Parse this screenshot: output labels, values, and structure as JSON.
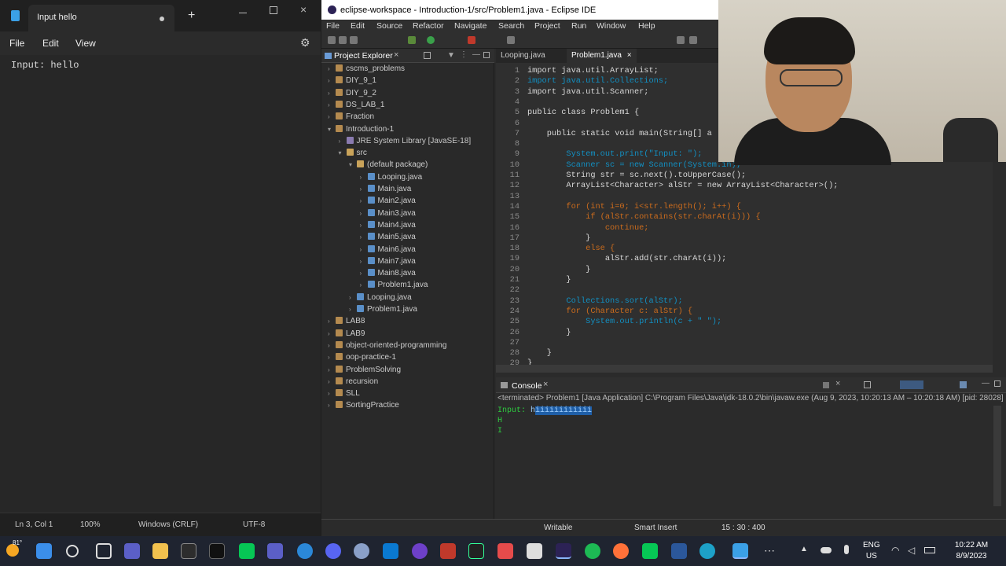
{
  "notepad": {
    "tab_title": "Input hello",
    "new_tab": "+",
    "menu": [
      "File",
      "Edit",
      "View"
    ],
    "content": "Input: hello",
    "status": {
      "position": "Ln 3, Col 1",
      "zoom": "100%",
      "eol": "Windows (CRLF)",
      "encoding": "UTF-8"
    }
  },
  "eclipse": {
    "title": "eclipse-workspace - Introduction-1/src/Problem1.java - Eclipse IDE",
    "menu": [
      "File",
      "Edit",
      "Source",
      "Refactor",
      "Navigate",
      "Search",
      "Project",
      "Run",
      "Window",
      "Help"
    ],
    "explorer": {
      "title": "Project Explorer",
      "items": [
        {
          "label": "cscms_problems",
          "depth": 0,
          "kind": "project"
        },
        {
          "label": "DIY_9_1",
          "depth": 0,
          "kind": "project"
        },
        {
          "label": "DIY_9_2",
          "depth": 0,
          "kind": "project"
        },
        {
          "label": "DS_LAB_1",
          "depth": 0,
          "kind": "project"
        },
        {
          "label": "Fraction",
          "depth": 0,
          "kind": "project"
        },
        {
          "label": "Introduction-1",
          "depth": 0,
          "kind": "project"
        },
        {
          "label": "JRE System Library [JavaSE-18]",
          "depth": 1,
          "kind": "lib"
        },
        {
          "label": "src",
          "depth": 1,
          "kind": "src"
        },
        {
          "label": "(default package)",
          "depth": 2,
          "kind": "pkg"
        },
        {
          "label": "Looping.java",
          "depth": 3,
          "kind": "java"
        },
        {
          "label": "Main.java",
          "depth": 3,
          "kind": "java"
        },
        {
          "label": "Main2.java",
          "depth": 3,
          "kind": "java"
        },
        {
          "label": "Main3.java",
          "depth": 3,
          "kind": "java"
        },
        {
          "label": "Main4.java",
          "depth": 3,
          "kind": "java"
        },
        {
          "label": "Main5.java",
          "depth": 3,
          "kind": "java"
        },
        {
          "label": "Main6.java",
          "depth": 3,
          "kind": "java"
        },
        {
          "label": "Main7.java",
          "depth": 3,
          "kind": "java"
        },
        {
          "label": "Main8.java",
          "depth": 3,
          "kind": "java"
        },
        {
          "label": "Problem1.java",
          "depth": 3,
          "kind": "java"
        },
        {
          "label": "Looping.java",
          "depth": 2,
          "kind": "java"
        },
        {
          "label": "Problem1.java",
          "depth": 2,
          "kind": "java"
        },
        {
          "label": "LAB8",
          "depth": 0,
          "kind": "project"
        },
        {
          "label": "LAB9",
          "depth": 0,
          "kind": "project"
        },
        {
          "label": "object-oriented-programming",
          "depth": 0,
          "kind": "project"
        },
        {
          "label": "oop-practice-1",
          "depth": 0,
          "kind": "project"
        },
        {
          "label": "ProblemSolving",
          "depth": 0,
          "kind": "project"
        },
        {
          "label": "recursion",
          "depth": 0,
          "kind": "project"
        },
        {
          "label": "SLL",
          "depth": 0,
          "kind": "project"
        },
        {
          "label": "SortingPractice",
          "depth": 0,
          "kind": "project"
        }
      ]
    },
    "editor_tabs": [
      "Looping.java",
      "Problem1.java"
    ],
    "code": [
      "import java.util.ArrayList;",
      "import java.util.Collections;",
      "import java.util.Scanner;",
      "",
      "public class Problem1 {",
      "",
      "    public static void main(String[] a",
      "",
      "        System.out.print(\"Input: \");",
      "        Scanner sc = new Scanner(System.in);",
      "        String str = sc.next().toUpperCase();",
      "        ArrayList<Character> alStr = new ArrayList<Character>();",
      "",
      "        for (int i=0; i<str.length(); i++) {",
      "            if (alStr.contains(str.charAt(i))) {",
      "                continue;",
      "            }",
      "            else {",
      "                alStr.add(str.charAt(i));",
      "            }",
      "        }",
      "",
      "        Collections.sort(alStr);",
      "        for (Character c: alStr) {",
      "            System.out.println(c + \" \");",
      "        }",
      "",
      "    }",
      "}"
    ],
    "console": {
      "title": "Console",
      "info": "<terminated> Problem1 [Java Application] C:\\Program Files\\Java\\jdk-18.0.2\\bin\\javaw.exe  (Aug 9, 2023, 10:20:13 AM – 10:20:18 AM) [pid: 28028]",
      "prompt": "Input: ",
      "input_first": "h",
      "input_rest": "iiiiiiiiiiii",
      "lines": [
        "H",
        "I"
      ]
    },
    "status": {
      "writable": "Writable",
      "insert": "Smart Insert",
      "position": "15 : 30 : 400"
    }
  },
  "taskbar": {
    "weather": "81°",
    "lang": "ENG",
    "region": "US",
    "time": "10:22 AM",
    "date": "8/9/2023"
  },
  "colors": {
    "accent": "#1f5fa8",
    "console_text": "#2ecc40"
  }
}
